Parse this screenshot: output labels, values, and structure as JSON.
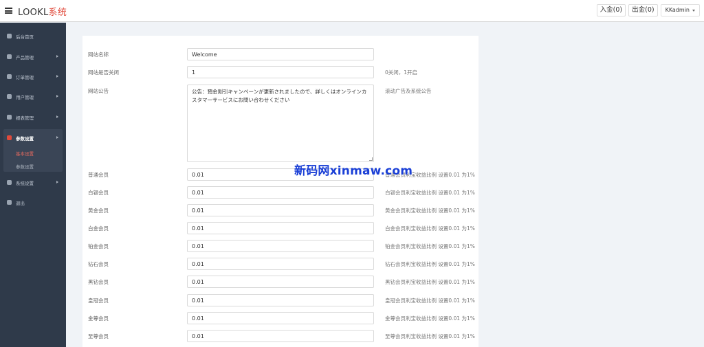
{
  "header": {
    "brand_main": "LOOKL",
    "brand_accent": "系统",
    "deposit_label": "入金(0)",
    "withdraw_label": "出金(0)",
    "user_name": "KKadmin"
  },
  "sidebar": {
    "items": [
      {
        "label": "后台首页",
        "icon": "dashboard-icon"
      },
      {
        "label": "产品管理",
        "icon": "bitcoin-icon"
      },
      {
        "label": "订单管理",
        "icon": "orders-icon"
      },
      {
        "label": "用户管理",
        "icon": "user-icon"
      },
      {
        "label": "报表管理",
        "icon": "yen-icon"
      },
      {
        "label": "参数设置",
        "icon": "copy-icon"
      },
      {
        "label": "系统设置",
        "icon": "gears-icon"
      },
      {
        "label": "退出",
        "icon": "sign-out-icon"
      }
    ],
    "sub_items": [
      {
        "label": "基本设置"
      },
      {
        "label": "参数设置"
      }
    ]
  },
  "form": {
    "rows": [
      {
        "label": "网站名称",
        "value": "Welcome",
        "hint": ""
      },
      {
        "label": "网站是否关闭",
        "value": "1",
        "hint": "0关闭，1开启"
      },
      {
        "label": "网站公告",
        "value": "公告：預金割引キャンペーンが更新されましたので、詳しくはオンラインカスタマーサービスにお問い合わせください",
        "hint": "滚动广告及系统公告"
      },
      {
        "label": "普通会员",
        "value": "0.01",
        "hint": "普通会员利宝收益比例 设置0.01 为1%"
      },
      {
        "label": "白银会员",
        "value": "0.01",
        "hint": "白银会员利宝收益比例 设置0.01 为1%"
      },
      {
        "label": "黄金会员",
        "value": "0.01",
        "hint": "黄金会员利宝收益比例 设置0.01 为1%"
      },
      {
        "label": "白金会员",
        "value": "0.01",
        "hint": "白金会员利宝收益比例 设置0.01 为1%"
      },
      {
        "label": "铂金会员",
        "value": "0.01",
        "hint": "铂金会员利宝收益比例 设置0.01 为1%"
      },
      {
        "label": "钻石会员",
        "value": "0.01",
        "hint": "钻石会员利宝收益比例 设置0.01 为1%"
      },
      {
        "label": "黑钻会员",
        "value": "0.01",
        "hint": "黑钻会员利宝收益比例 设置0.01 为1%"
      },
      {
        "label": "皇冠会员",
        "value": "0.01",
        "hint": "皇冠会员利宝收益比例 设置0.01 为1%"
      },
      {
        "label": "金尊会员",
        "value": "0.01",
        "hint": "金尊会员利宝收益比例 设置0.01 为1%"
      },
      {
        "label": "至尊会员",
        "value": "0.01",
        "hint": "至尊会员利宝收益比例 设置0.01 为1%"
      }
    ]
  },
  "watermark": "新码网xinmaw.com",
  "colors": {
    "accent": "#e04a3b",
    "sidebar_bg": "#2f3a4a",
    "page_bg": "#f0f3f7",
    "watermark": "#1a3fd6"
  }
}
